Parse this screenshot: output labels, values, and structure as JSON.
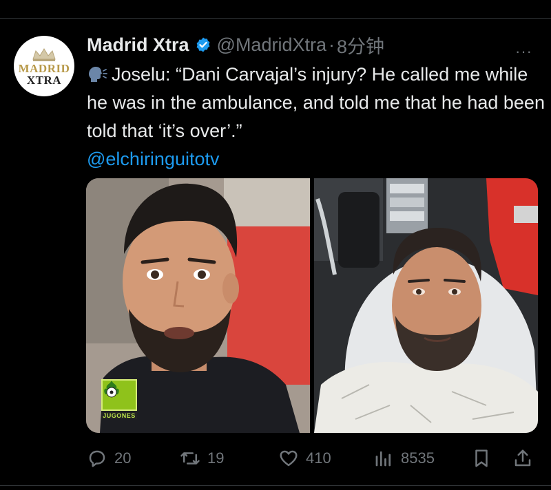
{
  "author": {
    "name": "Madrid Xtra",
    "handle": "@MadridXtra",
    "separator": "·",
    "time": "8分钟",
    "avatar_line1": "MADRID",
    "avatar_line2": "XTRA",
    "verified": true,
    "verified_color": "#1d9bf0"
  },
  "post": {
    "text": "Joselu: “Dani Carvajal’s injury? He called me while he was in the ambulance, and told me that he had been told that ‘it’s over’.”",
    "mention": "@elchiringuitotv",
    "leading_icon": "speaking-head-icon"
  },
  "media": {
    "watermark": "JUGONES",
    "left_panel": "man speaking to camera",
    "right_panel": "man lying on ambulance stretcher"
  },
  "more_label": "···",
  "actions": {
    "replies": "20",
    "reposts": "19",
    "likes": "410",
    "views": "8535"
  },
  "colors": {
    "background": "#000000",
    "text": "#e7e9ea",
    "muted": "#71767b",
    "link": "#1d9bf0"
  }
}
